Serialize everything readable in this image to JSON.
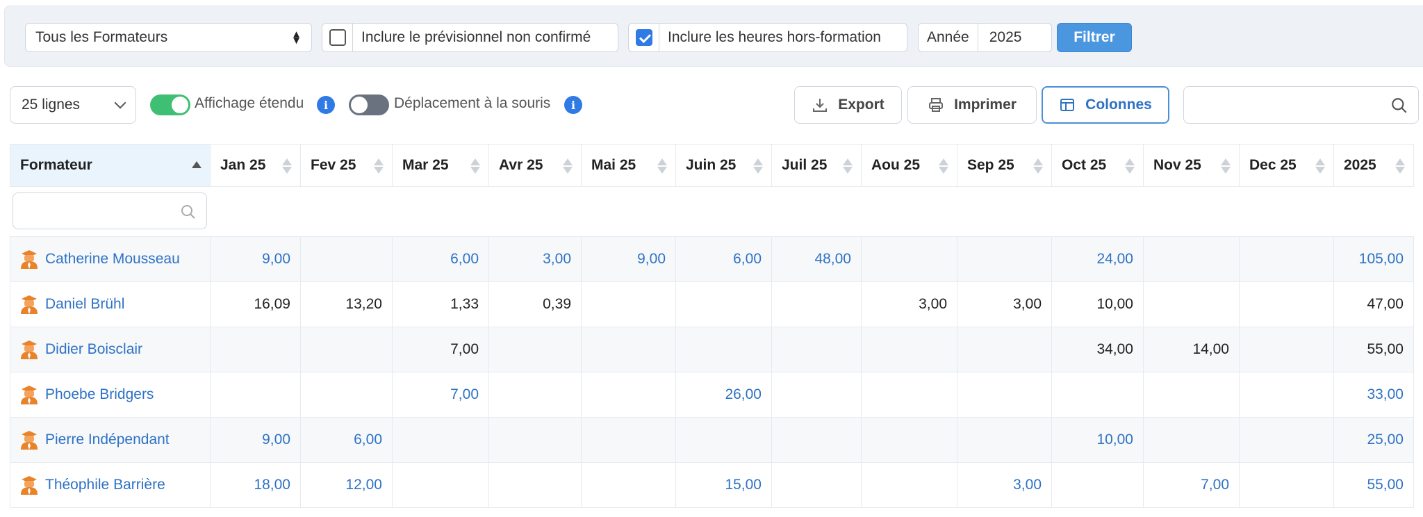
{
  "filters": {
    "formateur_select": "Tous les Formateurs",
    "include_previsionnel": {
      "label": "Inclure le prévisionnel non confirmé",
      "checked": false
    },
    "include_hors_formation": {
      "label": "Inclure les heures hors-formation",
      "checked": true
    },
    "annee_label": "Année",
    "annee_value": "2025",
    "filter_button": "Filtrer"
  },
  "toolbar": {
    "page_size": "25 lignes",
    "extended_view_label": "Affichage étendu",
    "extended_view_on": true,
    "mouse_move_label": "Déplacement à la souris",
    "mouse_move_on": false,
    "export_label": "Export",
    "print_label": "Imprimer",
    "columns_label": "Colonnes",
    "info_glyph": "i"
  },
  "colors": {
    "link": "#2f72c4",
    "accent": "#4a97e0",
    "toggle_on": "#3fbf74",
    "trainer_icon": "#e8832a"
  },
  "table": {
    "headers": [
      "Formateur",
      "Jan 25",
      "Fev 25",
      "Mar 25",
      "Avr 25",
      "Mai 25",
      "Juin 25",
      "Juil 25",
      "Aou 25",
      "Sep 25",
      "Oct 25",
      "Nov 25",
      "Dec 25",
      "2025"
    ],
    "rows": [
      {
        "name": "Catherine Mousseau",
        "linked": true,
        "values": [
          "9,00",
          "",
          "6,00",
          "3,00",
          "9,00",
          "6,00",
          "48,00",
          "",
          "",
          "24,00",
          "",
          "",
          "105,00"
        ]
      },
      {
        "name": "Daniel Brühl",
        "linked": false,
        "values": [
          "16,09",
          "13,20",
          "1,33",
          "0,39",
          "",
          "",
          "",
          "3,00",
          "3,00",
          "10,00",
          "",
          "",
          "47,00"
        ]
      },
      {
        "name": "Didier Boisclair",
        "linked": false,
        "values": [
          "",
          "",
          "7,00",
          "",
          "",
          "",
          "",
          "",
          "",
          "34,00",
          "14,00",
          "",
          "55,00"
        ]
      },
      {
        "name": "Phoebe Bridgers",
        "linked": true,
        "values": [
          "",
          "",
          "7,00",
          "",
          "",
          "26,00",
          "",
          "",
          "",
          "",
          "",
          "",
          "33,00"
        ]
      },
      {
        "name": "Pierre Indépendant",
        "linked": true,
        "values": [
          "9,00",
          "6,00",
          "",
          "",
          "",
          "",
          "",
          "",
          "",
          "10,00",
          "",
          "",
          "25,00"
        ]
      },
      {
        "name": "Théophile Barrière",
        "linked": true,
        "values": [
          "18,00",
          "12,00",
          "",
          "",
          "",
          "15,00",
          "",
          "",
          "3,00",
          "",
          "7,00",
          "",
          "55,00"
        ]
      }
    ]
  }
}
